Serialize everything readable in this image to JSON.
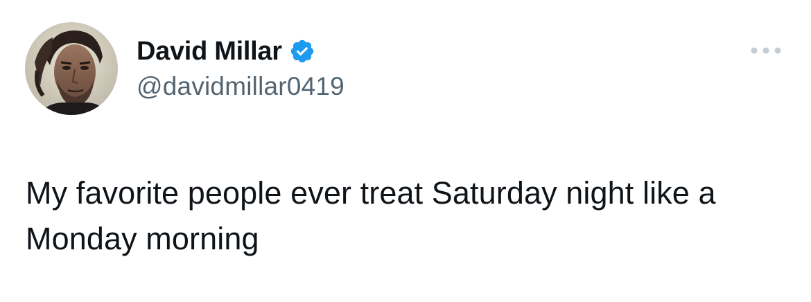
{
  "author": {
    "display_name": "David Millar",
    "handle": "@davidmillar0419",
    "verified": true,
    "avatar": "profile-photo"
  },
  "tweet": {
    "text": "My favorite people ever treat Saturday night like a Monday morning"
  },
  "icons": {
    "verified": "verified-badge-icon",
    "more": "more-options-icon"
  },
  "colors": {
    "text_primary": "#0f1419",
    "text_secondary": "#536471",
    "verified_blue": "#1d9bf0",
    "more_icon": "#c4cdd4",
    "background": "#ffffff"
  }
}
